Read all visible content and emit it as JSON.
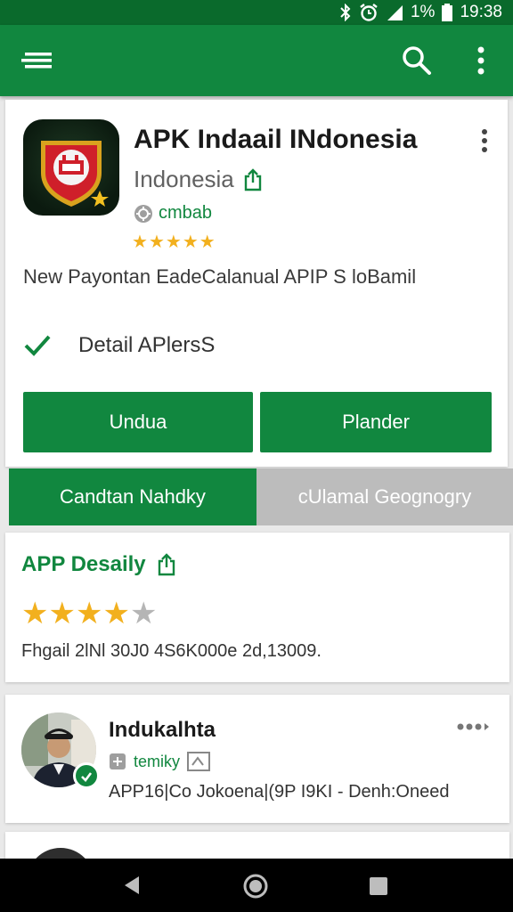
{
  "status_bar": {
    "battery_text": "1%",
    "time": "19:38"
  },
  "app_bar": {
    "icons": [
      "menu-icon",
      "search-icon",
      "overflow-menu-icon"
    ],
    "color": "#11873f"
  },
  "app": {
    "title": "APK Indaail INdonesia",
    "developer": "Indonesia",
    "category": "cmbab",
    "star_rating": 5,
    "description": "New  Payontan EadeCalanual APIP S loBamil",
    "detail_label": "Detail APlersS",
    "buttons": {
      "primary": "Undua",
      "secondary": "Plander"
    }
  },
  "tabs": [
    {
      "label": "Candtan Nahdky",
      "active": true
    },
    {
      "label": "cUlamal Geognogry",
      "active": false
    }
  ],
  "rating_card": {
    "title": "APP Desaily",
    "stars": 4,
    "max_stars": 5,
    "meta": "Fhgail 2lNl 30J0 4S6K000e 2d,13009."
  },
  "review": {
    "name": "Indukalhta",
    "tag": "temiky",
    "text": "APP16|Co Jokoena|(9P I9KI - Denh:Oneed"
  },
  "colors": {
    "primary": "#11873f",
    "status": "#0a6a2c",
    "star": "#f2b01e"
  }
}
